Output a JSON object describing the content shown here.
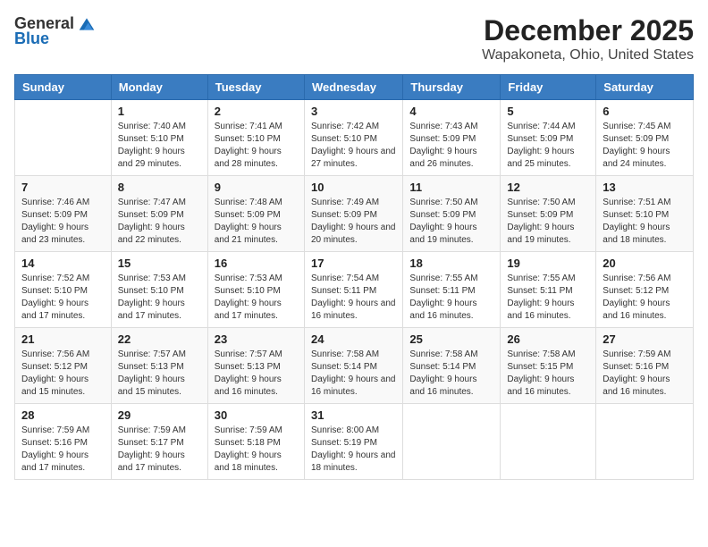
{
  "logo": {
    "general": "General",
    "blue": "Blue"
  },
  "title": "December 2025",
  "location": "Wapakoneta, Ohio, United States",
  "weekdays": [
    "Sunday",
    "Monday",
    "Tuesday",
    "Wednesday",
    "Thursday",
    "Friday",
    "Saturday"
  ],
  "weeks": [
    [
      {
        "day": "",
        "sunrise": "",
        "sunset": "",
        "daylight": ""
      },
      {
        "day": "1",
        "sunrise": "Sunrise: 7:40 AM",
        "sunset": "Sunset: 5:10 PM",
        "daylight": "Daylight: 9 hours and 29 minutes."
      },
      {
        "day": "2",
        "sunrise": "Sunrise: 7:41 AM",
        "sunset": "Sunset: 5:10 PM",
        "daylight": "Daylight: 9 hours and 28 minutes."
      },
      {
        "day": "3",
        "sunrise": "Sunrise: 7:42 AM",
        "sunset": "Sunset: 5:10 PM",
        "daylight": "Daylight: 9 hours and 27 minutes."
      },
      {
        "day": "4",
        "sunrise": "Sunrise: 7:43 AM",
        "sunset": "Sunset: 5:09 PM",
        "daylight": "Daylight: 9 hours and 26 minutes."
      },
      {
        "day": "5",
        "sunrise": "Sunrise: 7:44 AM",
        "sunset": "Sunset: 5:09 PM",
        "daylight": "Daylight: 9 hours and 25 minutes."
      },
      {
        "day": "6",
        "sunrise": "Sunrise: 7:45 AM",
        "sunset": "Sunset: 5:09 PM",
        "daylight": "Daylight: 9 hours and 24 minutes."
      }
    ],
    [
      {
        "day": "7",
        "sunrise": "Sunrise: 7:46 AM",
        "sunset": "Sunset: 5:09 PM",
        "daylight": "Daylight: 9 hours and 23 minutes."
      },
      {
        "day": "8",
        "sunrise": "Sunrise: 7:47 AM",
        "sunset": "Sunset: 5:09 PM",
        "daylight": "Daylight: 9 hours and 22 minutes."
      },
      {
        "day": "9",
        "sunrise": "Sunrise: 7:48 AM",
        "sunset": "Sunset: 5:09 PM",
        "daylight": "Daylight: 9 hours and 21 minutes."
      },
      {
        "day": "10",
        "sunrise": "Sunrise: 7:49 AM",
        "sunset": "Sunset: 5:09 PM",
        "daylight": "Daylight: 9 hours and 20 minutes."
      },
      {
        "day": "11",
        "sunrise": "Sunrise: 7:50 AM",
        "sunset": "Sunset: 5:09 PM",
        "daylight": "Daylight: 9 hours and 19 minutes."
      },
      {
        "day": "12",
        "sunrise": "Sunrise: 7:50 AM",
        "sunset": "Sunset: 5:09 PM",
        "daylight": "Daylight: 9 hours and 19 minutes."
      },
      {
        "day": "13",
        "sunrise": "Sunrise: 7:51 AM",
        "sunset": "Sunset: 5:10 PM",
        "daylight": "Daylight: 9 hours and 18 minutes."
      }
    ],
    [
      {
        "day": "14",
        "sunrise": "Sunrise: 7:52 AM",
        "sunset": "Sunset: 5:10 PM",
        "daylight": "Daylight: 9 hours and 17 minutes."
      },
      {
        "day": "15",
        "sunrise": "Sunrise: 7:53 AM",
        "sunset": "Sunset: 5:10 PM",
        "daylight": "Daylight: 9 hours and 17 minutes."
      },
      {
        "day": "16",
        "sunrise": "Sunrise: 7:53 AM",
        "sunset": "Sunset: 5:10 PM",
        "daylight": "Daylight: 9 hours and 17 minutes."
      },
      {
        "day": "17",
        "sunrise": "Sunrise: 7:54 AM",
        "sunset": "Sunset: 5:11 PM",
        "daylight": "Daylight: 9 hours and 16 minutes."
      },
      {
        "day": "18",
        "sunrise": "Sunrise: 7:55 AM",
        "sunset": "Sunset: 5:11 PM",
        "daylight": "Daylight: 9 hours and 16 minutes."
      },
      {
        "day": "19",
        "sunrise": "Sunrise: 7:55 AM",
        "sunset": "Sunset: 5:11 PM",
        "daylight": "Daylight: 9 hours and 16 minutes."
      },
      {
        "day": "20",
        "sunrise": "Sunrise: 7:56 AM",
        "sunset": "Sunset: 5:12 PM",
        "daylight": "Daylight: 9 hours and 16 minutes."
      }
    ],
    [
      {
        "day": "21",
        "sunrise": "Sunrise: 7:56 AM",
        "sunset": "Sunset: 5:12 PM",
        "daylight": "Daylight: 9 hours and 15 minutes."
      },
      {
        "day": "22",
        "sunrise": "Sunrise: 7:57 AM",
        "sunset": "Sunset: 5:13 PM",
        "daylight": "Daylight: 9 hours and 15 minutes."
      },
      {
        "day": "23",
        "sunrise": "Sunrise: 7:57 AM",
        "sunset": "Sunset: 5:13 PM",
        "daylight": "Daylight: 9 hours and 16 minutes."
      },
      {
        "day": "24",
        "sunrise": "Sunrise: 7:58 AM",
        "sunset": "Sunset: 5:14 PM",
        "daylight": "Daylight: 9 hours and 16 minutes."
      },
      {
        "day": "25",
        "sunrise": "Sunrise: 7:58 AM",
        "sunset": "Sunset: 5:14 PM",
        "daylight": "Daylight: 9 hours and 16 minutes."
      },
      {
        "day": "26",
        "sunrise": "Sunrise: 7:58 AM",
        "sunset": "Sunset: 5:15 PM",
        "daylight": "Daylight: 9 hours and 16 minutes."
      },
      {
        "day": "27",
        "sunrise": "Sunrise: 7:59 AM",
        "sunset": "Sunset: 5:16 PM",
        "daylight": "Daylight: 9 hours and 16 minutes."
      }
    ],
    [
      {
        "day": "28",
        "sunrise": "Sunrise: 7:59 AM",
        "sunset": "Sunset: 5:16 PM",
        "daylight": "Daylight: 9 hours and 17 minutes."
      },
      {
        "day": "29",
        "sunrise": "Sunrise: 7:59 AM",
        "sunset": "Sunset: 5:17 PM",
        "daylight": "Daylight: 9 hours and 17 minutes."
      },
      {
        "day": "30",
        "sunrise": "Sunrise: 7:59 AM",
        "sunset": "Sunset: 5:18 PM",
        "daylight": "Daylight: 9 hours and 18 minutes."
      },
      {
        "day": "31",
        "sunrise": "Sunrise: 8:00 AM",
        "sunset": "Sunset: 5:19 PM",
        "daylight": "Daylight: 9 hours and 18 minutes."
      },
      {
        "day": "",
        "sunrise": "",
        "sunset": "",
        "daylight": ""
      },
      {
        "day": "",
        "sunrise": "",
        "sunset": "",
        "daylight": ""
      },
      {
        "day": "",
        "sunrise": "",
        "sunset": "",
        "daylight": ""
      }
    ]
  ]
}
